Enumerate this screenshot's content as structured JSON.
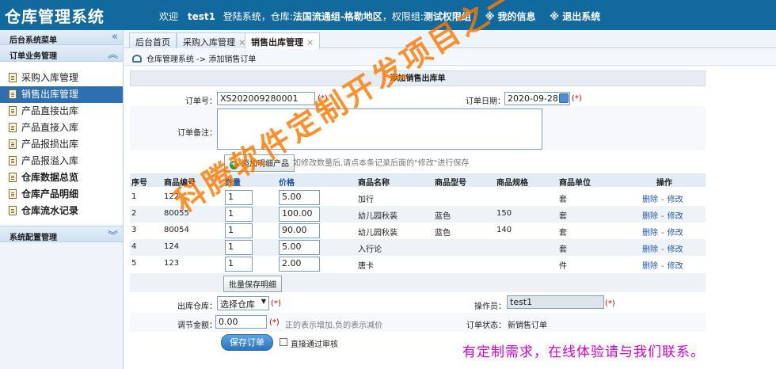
{
  "header": {
    "app_title": "仓库管理系统",
    "welcome": "欢迎",
    "user": "test1",
    "login_text": "登陆系统，仓库:",
    "warehouse": "法国流通组-格勒地区",
    "role_label": "，权限组:",
    "role": "测试权限组",
    "my_info": "※ 我的信息",
    "logout": "※ 退出系统"
  },
  "sidebar": {
    "menu_title": "后台系统菜单",
    "section_order": "订单业务管理",
    "items": [
      {
        "label": "采购入库管理",
        "bold": false,
        "active": false
      },
      {
        "label": "销售出库管理",
        "bold": false,
        "active": true
      },
      {
        "label": "产品直接出库",
        "bold": false,
        "active": false
      },
      {
        "label": "产品直接入库",
        "bold": false,
        "active": false
      },
      {
        "label": "产品报损出库",
        "bold": false,
        "active": false
      },
      {
        "label": "产品报溢入库",
        "bold": false,
        "active": false
      },
      {
        "label": "仓库数据总览",
        "bold": true,
        "active": false
      },
      {
        "label": "仓库产品明细",
        "bold": true,
        "active": false
      },
      {
        "label": "仓库流水记录",
        "bold": true,
        "active": false
      }
    ],
    "section_config": "系统配置管理"
  },
  "tabs": [
    {
      "label": "后台首页",
      "closable": false
    },
    {
      "label": "采购入库管理",
      "closable": true
    },
    {
      "label": "销售出库管理",
      "closable": true,
      "active": true
    }
  ],
  "breadcrumb": "仓库管理系统 -> 添加销售订单",
  "form": {
    "title": "添加销售出库单",
    "order_no_label": "订单号：",
    "order_no": "XS202009280001",
    "required_mark": "(*)",
    "order_date_label": "订单日期：",
    "order_date": "2020-09-28",
    "remark_label": "订单备注：",
    "add_detail_button": "添加明细产品",
    "add_detail_hint": "如修改数量后,请点本条记录后面的\"修改\"进行保存",
    "columns": [
      "序号",
      "商品编号",
      "数量",
      "价格",
      "商品名称",
      "商品型号",
      "商品规格",
      "商品单位",
      "操作"
    ],
    "rows": [
      {
        "seq": "1",
        "code": "122",
        "qty": "1",
        "price": "5.00",
        "name": "加行",
        "model": "",
        "spec": "",
        "unit": "套"
      },
      {
        "seq": "2",
        "code": "80055",
        "qty": "1",
        "price": "100.00",
        "name": "幼儿园秋装",
        "model": "蓝色",
        "spec": "150",
        "unit": "套"
      },
      {
        "seq": "3",
        "code": "80054",
        "qty": "1",
        "price": "90.00",
        "name": "幼儿园秋装",
        "model": "蓝色",
        "spec": "140",
        "unit": "套"
      },
      {
        "seq": "4",
        "code": "124",
        "qty": "1",
        "price": "5.00",
        "name": "入行论",
        "model": "",
        "spec": "",
        "unit": "套"
      },
      {
        "seq": "5",
        "code": "123",
        "qty": "1",
        "price": "2.00",
        "name": "唐卡",
        "model": "",
        "spec": "",
        "unit": "件"
      }
    ],
    "delete_label": "删除",
    "edit_label": "修改",
    "batch_save_button": "批量保存明细",
    "out_warehouse_label": "出库仓库：",
    "warehouse_select": "选择仓库",
    "operator_label": "操作员：",
    "operator": "test1",
    "adjust_label": "调节金额：",
    "adjust_amount": "0.00",
    "adjust_hint": "正的表示增加,负的表示减价",
    "status_label": "订单状态：",
    "status": "新销售订单",
    "save_button": "保存订单",
    "direct_approve_label": "直接通过审核"
  },
  "watermark": {
    "diagonal": "科腾软件定制开发项目之一",
    "bottom": "有定制需求，在线体验请与我们联系。"
  },
  "colors": {
    "header_bg": "#12699d",
    "active_menu": "#2d6fb0",
    "link": "#2456a5",
    "watermark_orange": "#ff7a00",
    "watermark_magenta": "#d400d4"
  }
}
